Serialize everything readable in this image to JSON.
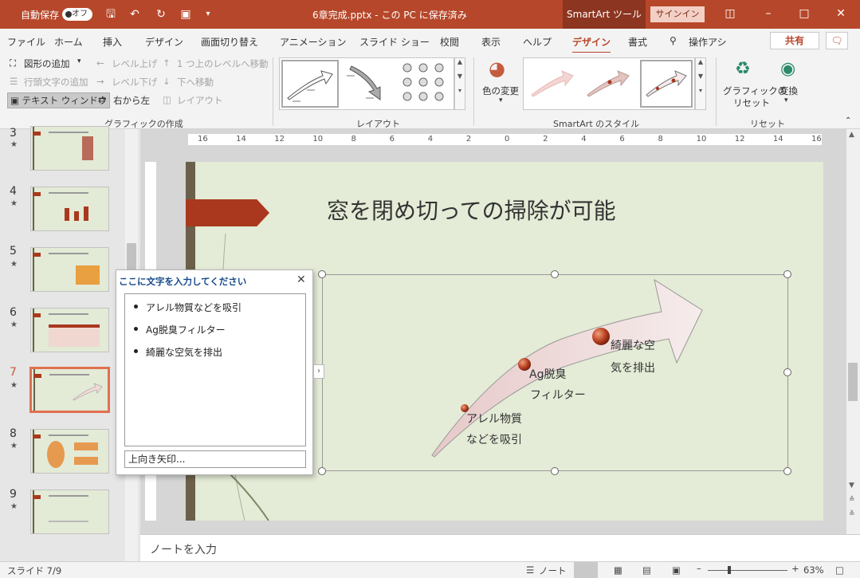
{
  "titlebar": {
    "autosave_label": "自動保存",
    "autosave_state": "オフ",
    "document_title": "6章完成.pptx - この PC に保存済み",
    "context_tool": "SmartArt ツール",
    "signin": "サインイン"
  },
  "tabs": [
    "ファイル",
    "ホーム",
    "挿入",
    "デザイン",
    "画面切り替え",
    "アニメーション",
    "スライド ショー",
    "校閲",
    "表示",
    "ヘルプ",
    "デザイン",
    "書式"
  ],
  "search_label": "操作アシ",
  "share_label": "共有",
  "ribbon": {
    "create": {
      "add_shape": "図形の追加",
      "promote": "レベル上げ",
      "move_up": "1 つ上のレベルへ移動",
      "add_bullet": "行頭文字の追加",
      "demote": "レベル下げ",
      "move_down": "下へ移動",
      "text_pane": "テキスト ウィンドウ",
      "rtl": "右から左",
      "layout": "レイアウト",
      "group": "グラフィックの作成"
    },
    "layouts_group": "レイアウト",
    "change_colors": "色の変更",
    "styles_group": "SmartArt のスタイル",
    "reset_graphic_1": "グラフィックの",
    "reset_graphic_2": "リセット",
    "convert": "変換",
    "reset_group": "リセット"
  },
  "ruler_labels": [
    "16",
    "14",
    "12",
    "10",
    "8",
    "6",
    "4",
    "2",
    "0",
    "2",
    "4",
    "6",
    "8",
    "10",
    "12",
    "14",
    "16"
  ],
  "thumbnails": [
    {
      "num": "3",
      "current": false
    },
    {
      "num": "4",
      "current": false
    },
    {
      "num": "5",
      "current": false
    },
    {
      "num": "6",
      "current": false
    },
    {
      "num": "7",
      "current": true
    },
    {
      "num": "8",
      "current": false
    },
    {
      "num": "9",
      "current": false
    }
  ],
  "slide": {
    "title": "窓を閉め切っての掃除が可能",
    "labels": [
      {
        "l1": "アレル物質",
        "l2": "などを吸引"
      },
      {
        "l1": "Ag脱臭",
        "l2": "フィルター"
      },
      {
        "l1": "綺麗な空",
        "l2": "気を排出"
      }
    ]
  },
  "text_pane": {
    "header": "ここに文字を入力してください",
    "items": [
      "アレル物質などを吸引",
      "Ag脱臭フィルター",
      "綺麗な空気を排出"
    ],
    "footer": "上向き矢印..."
  },
  "notes_placeholder": "ノートを入力",
  "status": {
    "slide_info": "スライド 7/9",
    "notes": "ノート",
    "zoom": "63%"
  }
}
